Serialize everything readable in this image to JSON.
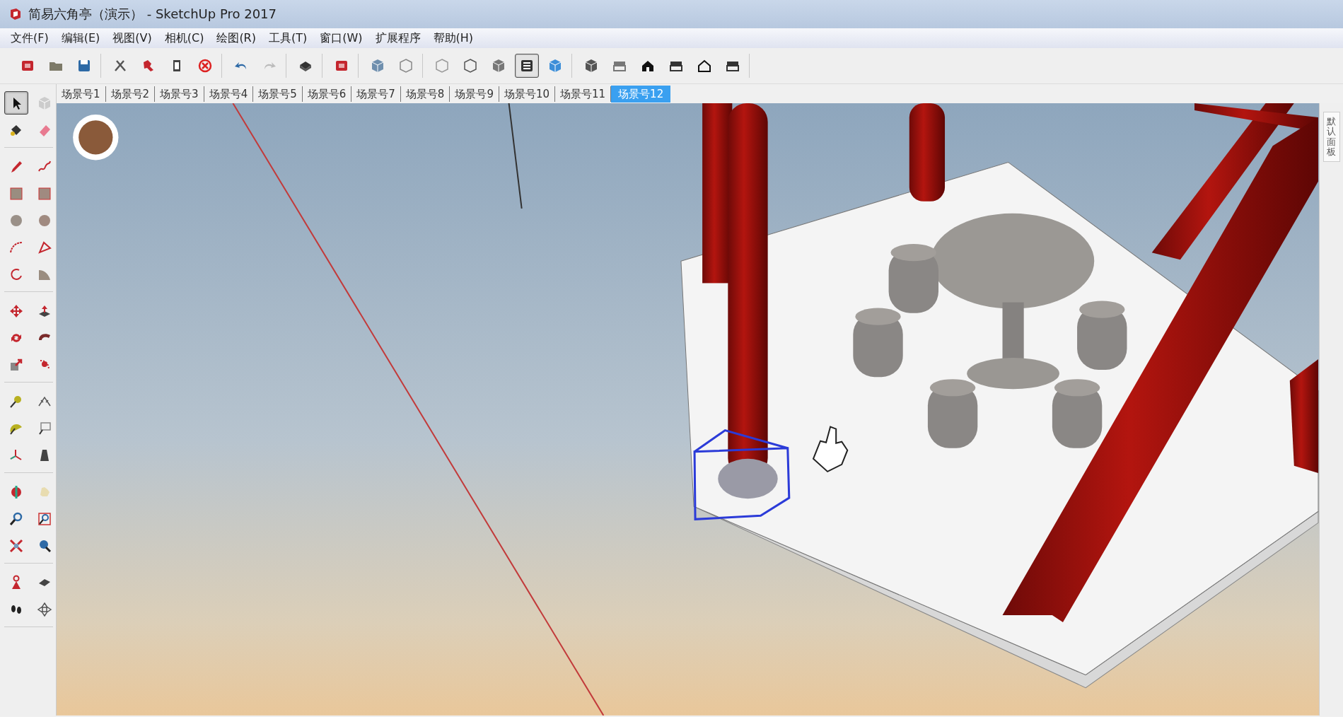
{
  "window": {
    "title": "简易六角亭（演示） - SketchUp Pro 2017"
  },
  "menu": [
    {
      "label": "文件(F)"
    },
    {
      "label": "编辑(E)"
    },
    {
      "label": "视图(V)"
    },
    {
      "label": "相机(C)"
    },
    {
      "label": "绘图(R)"
    },
    {
      "label": "工具(T)"
    },
    {
      "label": "窗口(W)"
    },
    {
      "label": "扩展程序"
    },
    {
      "label": "帮助(H)"
    }
  ],
  "main_toolbar": [
    {
      "selected": false
    },
    {
      "selected": false
    },
    {
      "selected": false
    },
    {
      "selected": false
    },
    {
      "selected": false
    },
    {
      "selected": false
    },
    {
      "selected": false
    },
    {
      "selected": false
    },
    {
      "selected": false
    },
    {
      "selected": false
    },
    {
      "selected": false
    },
    {
      "selected": false
    },
    {
      "selected": false
    },
    {
      "selected": false
    },
    {
      "selected": false
    },
    {
      "selected": false
    },
    {
      "selected": true
    },
    {
      "selected": false
    },
    {
      "selected": false
    },
    {
      "selected": false
    },
    {
      "selected": false
    },
    {
      "selected": false
    },
    {
      "selected": false
    },
    {
      "selected": false
    }
  ],
  "scene_tabs": [
    {
      "label": "场景号1",
      "selected": false
    },
    {
      "label": "场景号2",
      "selected": false
    },
    {
      "label": "场景号3",
      "selected": false
    },
    {
      "label": "场景号4",
      "selected": false
    },
    {
      "label": "场景号5",
      "selected": false
    },
    {
      "label": "场景号6",
      "selected": false
    },
    {
      "label": "场景号7",
      "selected": false
    },
    {
      "label": "场景号8",
      "selected": false
    },
    {
      "label": "场景号9",
      "selected": false
    },
    {
      "label": "场景号10",
      "selected": false
    },
    {
      "label": "场景号11",
      "selected": false
    },
    {
      "label": "场景号12",
      "selected": true
    }
  ],
  "tool_palette": [
    {
      "selected": true
    },
    {
      "selected": false
    },
    {
      "selected": false
    },
    {
      "selected": false
    },
    {
      "selected": false
    },
    {
      "selected": false
    },
    {
      "selected": false
    },
    {
      "selected": false
    },
    {
      "selected": false
    },
    {
      "selected": false
    },
    {
      "selected": false
    },
    {
      "selected": false
    },
    {
      "selected": false
    },
    {
      "selected": false
    },
    {
      "selected": false
    },
    {
      "selected": false
    },
    {
      "selected": false
    },
    {
      "selected": false
    },
    {
      "selected": false
    },
    {
      "selected": false
    },
    {
      "selected": false
    },
    {
      "selected": false
    },
    {
      "selected": false
    },
    {
      "selected": false
    },
    {
      "selected": false
    },
    {
      "selected": false
    },
    {
      "selected": false
    },
    {
      "selected": false
    },
    {
      "selected": false
    },
    {
      "selected": false
    },
    {
      "selected": false
    },
    {
      "selected": false
    },
    {
      "selected": false
    },
    {
      "selected": false
    },
    {
      "selected": false
    },
    {
      "selected": false
    }
  ],
  "tray": {
    "title": "默认面板"
  }
}
